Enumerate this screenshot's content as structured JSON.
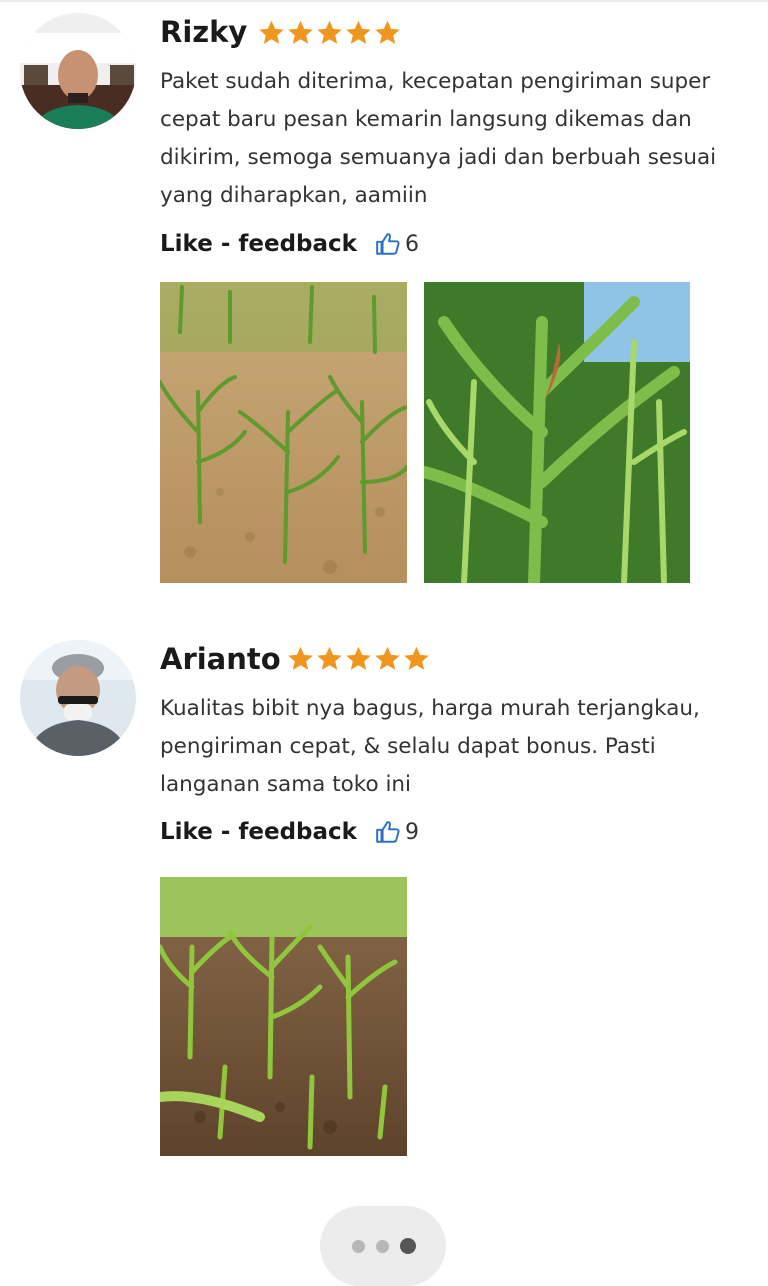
{
  "reviews": [
    {
      "name": "Rizky",
      "rating": 5,
      "text": "Paket sudah diterima, kecepatan pengiriman super cepat baru pesan kemarin langsung dikemas dan dikirim, semoga semuanya jadi dan berbuah sesuai yang diharapkan, aamiin",
      "feedback_label": "Like - feedback",
      "like_count": "6"
    },
    {
      "name": "Arianto",
      "rating": 5,
      "text": "Kualitas bibit nya bagus, harga murah terjangkau, pengiriman cepat, & selalu dapat bonus. Pasti langanan sama toko ini",
      "feedback_label": "Like - feedback",
      "like_count": "9"
    }
  ],
  "pagination": {
    "total": 3,
    "active": 3
  },
  "colors": {
    "star": "#F0961E",
    "thumb": "#2A6FC9",
    "pager_bg": "#ECECEC"
  },
  "icons": {
    "rating": "star-icon",
    "like": "thumbs-up-icon"
  }
}
